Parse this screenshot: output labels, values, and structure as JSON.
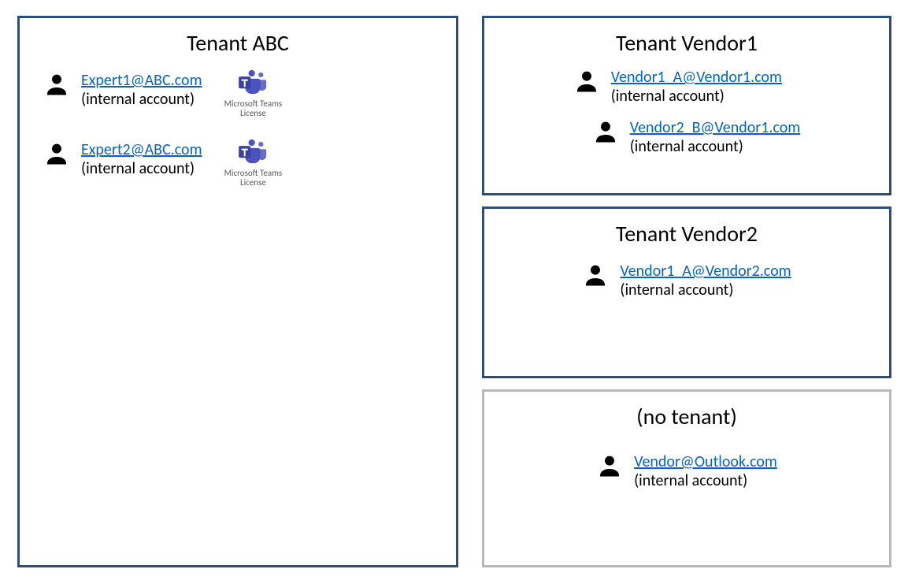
{
  "left_box": {
    "title": "Tenant ABC",
    "users": [
      {
        "email": "Expert1@ABC.com",
        "type": "(internal account)",
        "teams_label1": "Microsoft Teams",
        "teams_label2": "License"
      },
      {
        "email": "Expert2@ABC.com",
        "type": "(internal account)",
        "teams_label1": "Microsoft Teams",
        "teams_label2": "License"
      }
    ]
  },
  "right_boxes": [
    {
      "title": "Tenant Vendor1",
      "border": "navy",
      "users": [
        {
          "email": "Vendor1_A@Vendor1.com",
          "type": "(internal account)"
        },
        {
          "email": "Vendor2_B@Vendor1.com",
          "type": "(internal account)"
        }
      ]
    },
    {
      "title": "Tenant Vendor2",
      "border": "navy",
      "users": [
        {
          "email": "Vendor1_A@Vendor2.com",
          "type": "(internal account)"
        }
      ]
    },
    {
      "title": "(no tenant)",
      "border": "grey",
      "users": [
        {
          "email": "Vendor@Outlook.com",
          "type": "(internal account)"
        }
      ]
    }
  ]
}
